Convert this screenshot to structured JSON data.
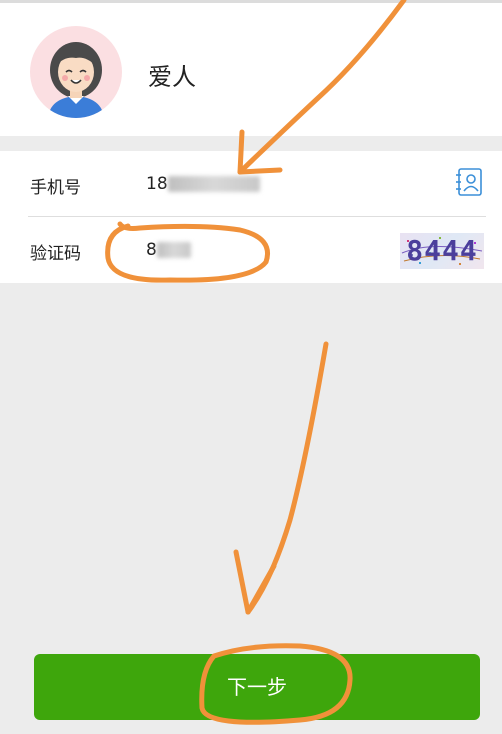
{
  "contact": {
    "name": "爱人",
    "avatar_icon": "female-avatar-icon"
  },
  "form": {
    "phone": {
      "label": "手机号",
      "value_visible": "18",
      "action_icon": "contacts-icon"
    },
    "code": {
      "label": "验证码",
      "value_visible": "8",
      "captcha_text": "8444"
    }
  },
  "actions": {
    "next_label": "下一步"
  },
  "colors": {
    "primary": "#3ea60c",
    "annotation": "#f0913a",
    "avatar_bg": "#fbdfe2"
  }
}
